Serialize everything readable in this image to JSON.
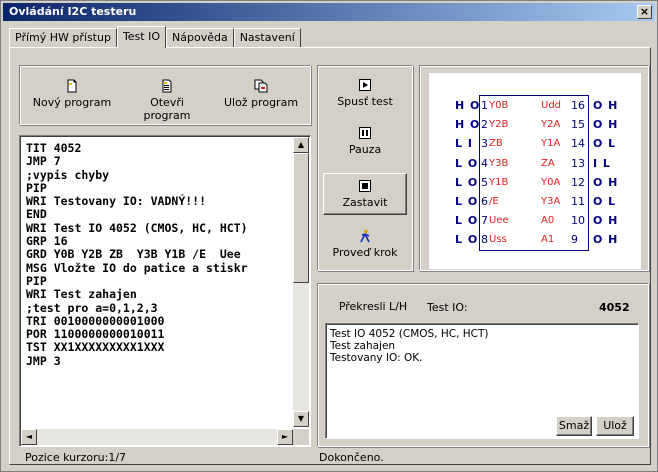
{
  "window": {
    "title": "Ovládání I2C testeru",
    "close": "×"
  },
  "tabs": [
    {
      "label": "Přímý HW přístup"
    },
    {
      "label": "Test IO"
    },
    {
      "label": "Nápověda"
    },
    {
      "label": "Nastavení"
    }
  ],
  "toolbar": {
    "new": "Nový program",
    "open": "Otevři program",
    "save": "Ulož program"
  },
  "editor": {
    "lines": "TIT 4052\nJMP 7\n;vypis chyby\nPIP\nWRI Testovany IO: VADNÝ!!!\nEND\nWRI Test IO 4052 (CMOS, HC, HCT)\nGRP 16\nGRD Y0B Y2B ZB  Y3B Y1B /E  Uee\nMSG Vložte IO do patice a stiskr\nPIP\nWRI Test zahajen\n;test pro a=0,1,2,3\nTRI 0010000000001000\nPOR 1100000000010011\nTST XX1XXXXXXXXX1XXX\nJMP 3"
  },
  "controls": {
    "run": "Spusť test",
    "pause": "Pauza",
    "stop": "Zastavit",
    "step": "Proveď krok"
  },
  "chip": {
    "left": [
      {
        "lvl": "H O",
        "num": "1",
        "name": "Y0B"
      },
      {
        "lvl": "H O",
        "num": "2",
        "name": "Y2B"
      },
      {
        "lvl": "L I",
        "num": "3",
        "name": "ZB"
      },
      {
        "lvl": "L O",
        "num": "4",
        "name": "Y3B"
      },
      {
        "lvl": "L O",
        "num": "5",
        "name": "Y1B"
      },
      {
        "lvl": "L O",
        "num": "6",
        "name": "/E"
      },
      {
        "lvl": "L O",
        "num": "7",
        "name": "Uee"
      },
      {
        "lvl": "L O",
        "num": "8",
        "name": "Uss"
      }
    ],
    "right": [
      {
        "name": "Udd",
        "num": "16",
        "lvl": "O H"
      },
      {
        "name": "Y2A",
        "num": "15",
        "lvl": "O H"
      },
      {
        "name": "Y1A",
        "num": "14",
        "lvl": "O L"
      },
      {
        "name": "ZA",
        "num": "13",
        "lvl": "I L"
      },
      {
        "name": "Y0A",
        "num": "12",
        "lvl": "O H"
      },
      {
        "name": "Y3A",
        "num": "11",
        "lvl": "O L"
      },
      {
        "name": "A0",
        "num": "10",
        "lvl": "O H"
      },
      {
        "name": "A1",
        "num": "9",
        "lvl": "O H"
      }
    ]
  },
  "redraw_label": "Překresli L/H",
  "test_io": {
    "label": "Test IO:",
    "value": "4052"
  },
  "output": {
    "text": "Test IO 4052 (CMOS, HC, HCT)\nTest zahajen\nTestovany IO: OK."
  },
  "output_buttons": {
    "clear": "Smaž",
    "save": "Ulož"
  },
  "status": {
    "cursor": "Pozice kurzoru:1/7",
    "state": "Dokončeno."
  }
}
